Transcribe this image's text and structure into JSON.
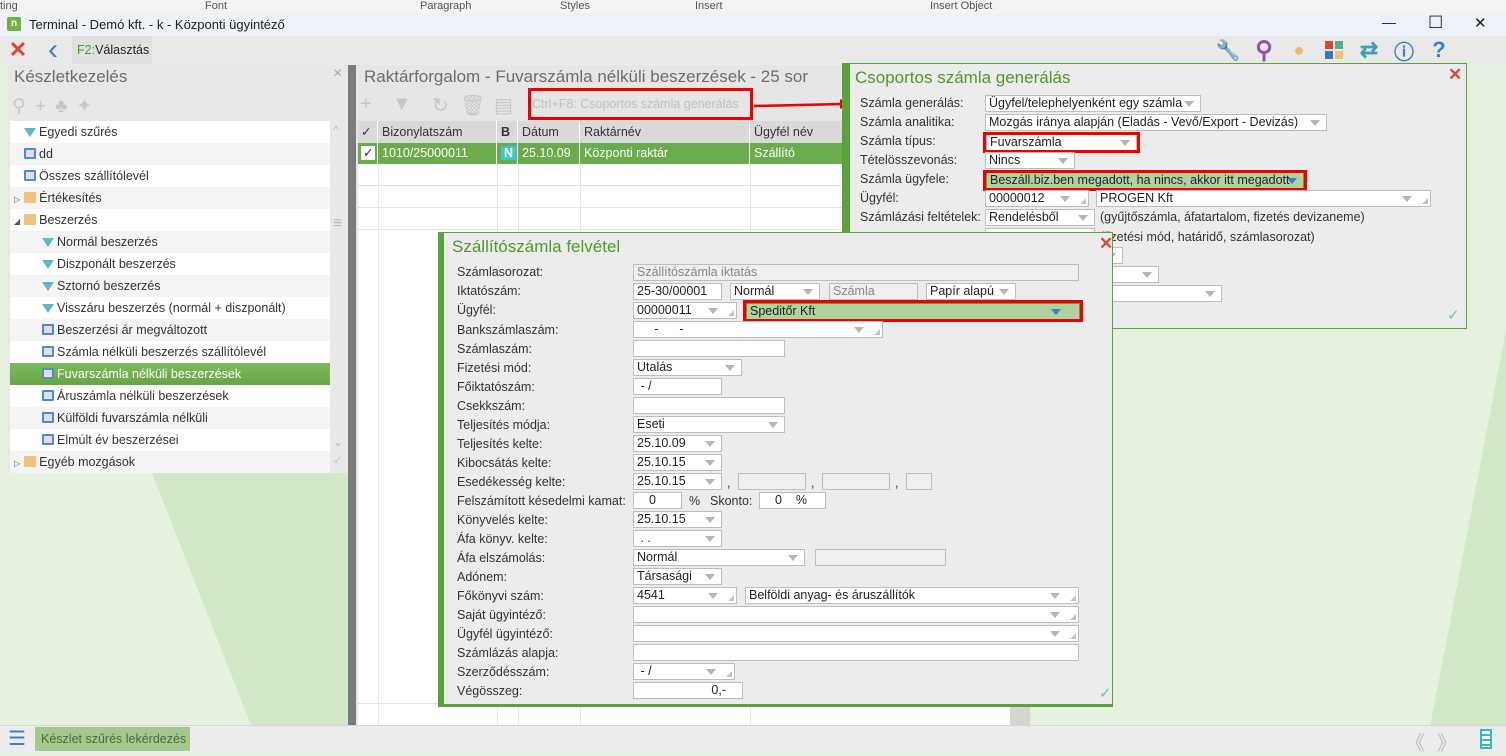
{
  "ribbon": {
    "items": [
      "ting",
      "Font",
      "Paragraph",
      "Styles",
      "Insert",
      "Insert Object"
    ]
  },
  "window": {
    "title": "Terminal - Demó kft. - k - Központi ügyintéző",
    "minimize": "—",
    "maximize": "☐",
    "close": "✕"
  },
  "toolbar": {
    "close": "✕",
    "back": "‹",
    "select_key": "F2:",
    "select_label": "Választás",
    "right_icons": [
      "wrench-icon",
      "search-icon",
      "user-icon",
      "apps-icon",
      "swap-icon",
      "info-icon",
      "help-icon"
    ],
    "right_glyphs": [
      "🔧",
      "⚲",
      "●",
      "■",
      "⇄",
      "ⓘ",
      "?"
    ]
  },
  "left_panel": {
    "title": "Készletkezelés",
    "close": "×",
    "items": [
      {
        "label": "Egyedi szűrés",
        "icon": "funnel",
        "level": 1
      },
      {
        "label": "dd",
        "icon": "monitor",
        "level": 1
      },
      {
        "label": "Összes szállítólevél",
        "icon": "monitor",
        "level": 1
      },
      {
        "label": "Értékesítés",
        "icon": "folder",
        "level": 0,
        "expander": "▷"
      },
      {
        "label": "Beszerzés",
        "icon": "folder",
        "level": 0,
        "expander": "◢"
      },
      {
        "label": "Normál beszerzés",
        "icon": "funnel",
        "level": 2
      },
      {
        "label": "Diszponált beszerzés",
        "icon": "funnel",
        "level": 2
      },
      {
        "label": "Sztornó beszerzés",
        "icon": "funnel",
        "level": 2
      },
      {
        "label": "Visszáru beszerzés (normál + diszponált)",
        "icon": "funnel",
        "level": 2
      },
      {
        "label": "Beszerzési ár megváltozott",
        "icon": "monitor",
        "level": 2
      },
      {
        "label": "Számla nélküli beszerzés szállítólevél",
        "icon": "monitor",
        "level": 2
      },
      {
        "label": "Fuvarszámla nélküli beszerzések",
        "icon": "monitor",
        "level": 2,
        "selected": true
      },
      {
        "label": "Áruszámla nélküli beszerzések",
        "icon": "monitor",
        "level": 2
      },
      {
        "label": "Külföldi fuvarszámla nélküli",
        "icon": "monitor",
        "level": 2
      },
      {
        "label": "Elmúlt év beszerzései",
        "icon": "monitor",
        "level": 2
      },
      {
        "label": "Egyéb mozgások",
        "icon": "folder",
        "level": 0,
        "expander": "▷"
      }
    ]
  },
  "main": {
    "title": "Raktárforgalom - Fuvarszámla nélküli beszerzések - 25 sor",
    "hint": "Ctrl+F8: Csoportos számla generálás",
    "columns": [
      "✓",
      "Bizonylatszám",
      "B",
      "Dátum",
      "Raktárnév",
      "Ügyfél név"
    ],
    "rows": [
      {
        "checked": "✓",
        "doc": "1010/25000011",
        "b": "N",
        "date": "25.10.09",
        "warehouse": "Központi raktár",
        "customer": "Szállító"
      }
    ]
  },
  "group_dialog": {
    "title": "Csoportos számla generálás",
    "close": "✕",
    "ok": "✓",
    "fields": {
      "generation": {
        "label": "Számla generálás:",
        "value": "Ügyfel/telephelyenként egy számla"
      },
      "analytics": {
        "label": "Számla analitika:",
        "value": "Mozgás iránya alapján (Eladás - Vevő/Export - Devizás)"
      },
      "type": {
        "label": "Számla típus:",
        "value": "Fuvarszámla"
      },
      "merge": {
        "label": "Tételösszevonás:",
        "value": "Nincs"
      },
      "customer_mode": {
        "label": "Számla ügyfele:",
        "value": "Beszáll.biz.ben megadott, ha nincs, akkor itt megadott"
      },
      "customer": {
        "label": "Ügyfél:",
        "code": "00000012",
        "name": "PROGEN Kft"
      },
      "terms": {
        "label": "Számlázási feltételek:",
        "value": "Rendelésből",
        "note": "(gyűjtőszámla, áfatartalom, fizetés devizaneme)"
      },
      "terms2": {
        "note": "(fizetési mód, határidő, számlasorozat)"
      }
    }
  },
  "invoice_dialog": {
    "title": "Szállítószámla felvétel",
    "close": "✕",
    "ok": "✓",
    "series": {
      "label": "Számlasorozat:",
      "value": "Szállítószámla iktatás"
    },
    "reg_no": {
      "label": "Iktatószám:",
      "value": "25-30/00001",
      "kind": "Normál",
      "doc": "Számla",
      "medium": "Papír alapú"
    },
    "customer": {
      "label": "Ügyfél:",
      "code": "00000011",
      "name": "Speditőr Kft"
    },
    "bank": {
      "label": "Bankszámlaszám:",
      "value": "     -      -"
    },
    "invoice_no": {
      "label": "Számlaszám:",
      "value": ""
    },
    "payment": {
      "label": "Fizetési mód:",
      "value": "Utalás"
    },
    "main_reg": {
      "label": "Főiktatószám:",
      "value": " - /"
    },
    "cheque": {
      "label": "Csekkszám:",
      "value": ""
    },
    "fulfil_mode": {
      "label": "Teljesítés módja:",
      "value": "Eseti"
    },
    "fulfil_date": {
      "label": "Teljesítés kelte:",
      "value": "25.10.09"
    },
    "issue_date": {
      "label": "Kibocsátás kelte:",
      "value": "25.10.15"
    },
    "due_date": {
      "label": "Esedékesség kelte:",
      "value": "25.10.15",
      "sep": ","
    },
    "interest": {
      "label": "Felszámított késedelmi kamat:",
      "value": "0",
      "unit": "%",
      "skonto_label": "Skonto:",
      "skonto": "0    %"
    },
    "posting_date": {
      "label": "Könyvelés kelte:",
      "value": "25.10.15"
    },
    "vat_date": {
      "label": "Áfa könyv. kelte:",
      "value": " . ."
    },
    "vat_mode": {
      "label": "Áfa elszámolás:",
      "value": "Normál"
    },
    "tax": {
      "label": "Adónem:",
      "value": "Társasági"
    },
    "ledger": {
      "label": "Főkönyvi szám:",
      "code": "4541",
      "name": "Belföldi anyag- és áruszállítók"
    },
    "own_agent": {
      "label": "Saját ügyintéző:",
      "value": ""
    },
    "cust_agent": {
      "label": "Ügyfél ügyintéző:",
      "value": ""
    },
    "basis": {
      "label": "Számlázás alapja:",
      "value": ""
    },
    "contract": {
      "label": "Szerződésszám:",
      "value": " - /"
    },
    "total": {
      "label": "Végösszeg:",
      "value": "0,-"
    }
  },
  "bottom": {
    "menu": "☰",
    "tab": "Készlet szűrés lekérdezés",
    "prev": "《",
    "next": "》"
  },
  "colors": {
    "accent": "#5aa33a",
    "selection": "#6aab4b",
    "highlight": "#ee0000"
  }
}
